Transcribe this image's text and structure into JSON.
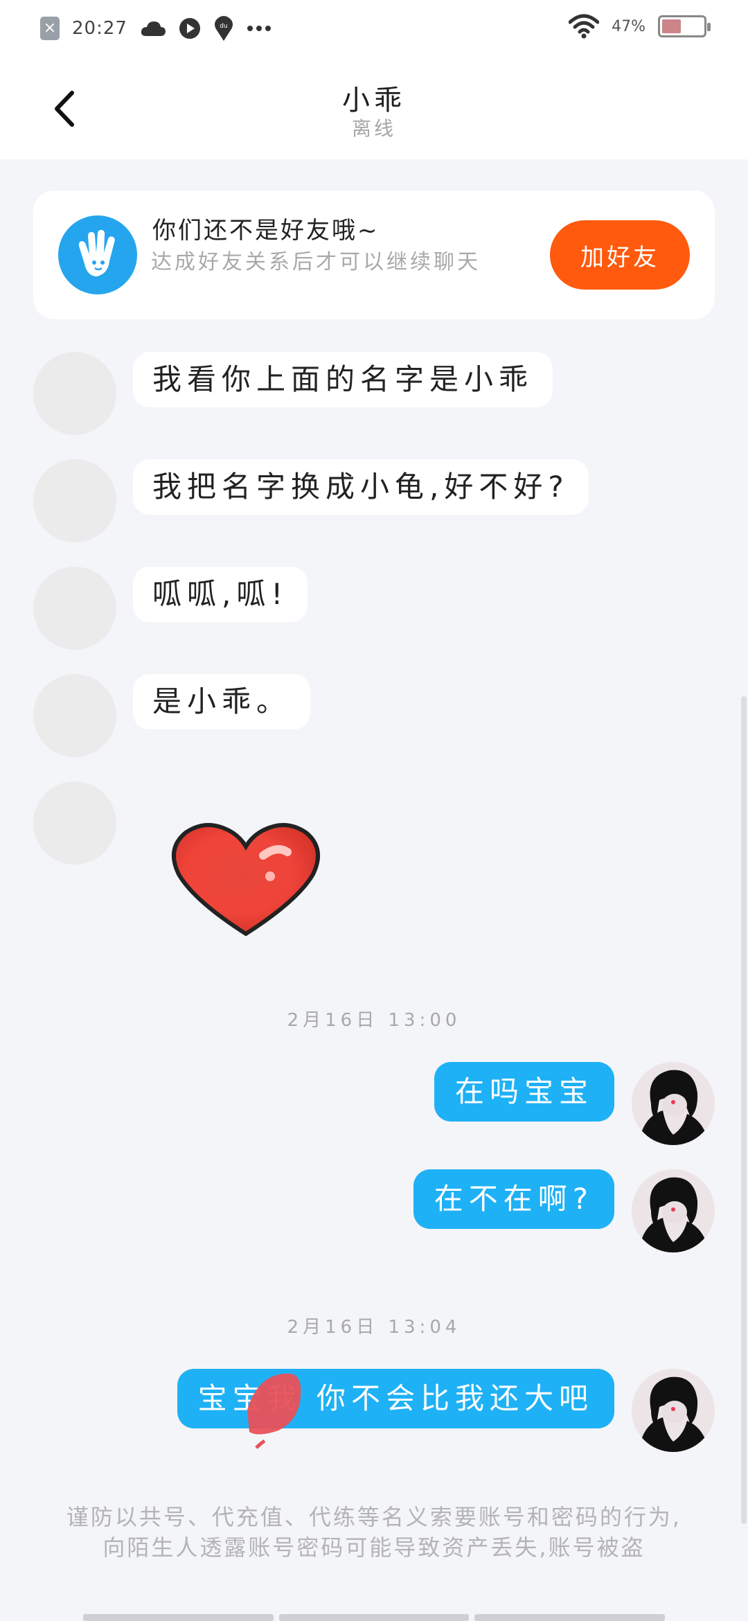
{
  "status_bar": {
    "time": "20:27",
    "battery": "47%",
    "battery_level": 0.47
  },
  "header": {
    "title": "小乖",
    "status": "离线"
  },
  "friend_notice": {
    "title": "你们还不是好友哦~",
    "description": "达成好友关系后才可以继续聊天",
    "button": "加好友"
  },
  "incoming_messages": [
    {
      "text": "我看你上面的名字是小乖"
    },
    {
      "text": "我把名字换成小龟,好不好?"
    },
    {
      "text": "呱呱,呱!"
    },
    {
      "text": "是小乖。"
    }
  ],
  "timestamps": [
    "2月16日 13:00",
    "2月16日 13:04"
  ],
  "outgoing_messages": [
    {
      "text": "在吗宝宝"
    },
    {
      "text": "在不在啊?"
    },
    {
      "text": "宝宝我  你不会比我还大吧"
    }
  ],
  "warning": "谨防以共号、代充值、代练等名义索要账号和密码的行为,向陌生人透露账号密码可能导致资产丢失,账号被盗",
  "colors": {
    "accent_blue": "#1fb1f5",
    "add_button": "#ff5a0e",
    "background": "#f4f5f8"
  }
}
